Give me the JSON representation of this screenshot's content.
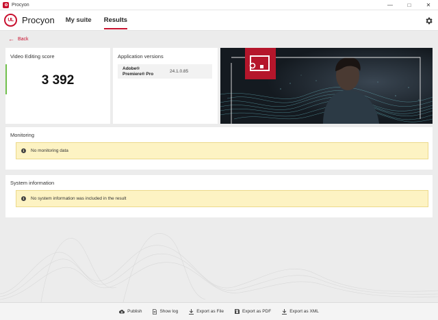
{
  "window": {
    "title": "Procyon"
  },
  "app": {
    "logo_text": "UL",
    "brand": "Procyon",
    "nav": [
      {
        "label": "My suite",
        "active": false
      },
      {
        "label": "Results",
        "active": true
      }
    ]
  },
  "back": {
    "label": "Back"
  },
  "score": {
    "title": "Video Editing score",
    "value": "3 392"
  },
  "apps": {
    "title": "Application versions",
    "items": [
      {
        "name": "Adobe® Premiere® Pro",
        "version": "24.1.0.85"
      }
    ]
  },
  "monitoring": {
    "title": "Monitoring",
    "message": "No monitoring data"
  },
  "system_info": {
    "title": "System information",
    "message": "No system information was included in the result"
  },
  "footer": {
    "publish": "Publish",
    "show_log": "Show log",
    "export_file": "Export as File",
    "export_pdf": "Export as PDF",
    "export_xml": "Export as XML"
  },
  "colors": {
    "accent": "#c8102e",
    "score_bar": "#6fbf4a",
    "notice_bg": "#fdf3c3"
  }
}
